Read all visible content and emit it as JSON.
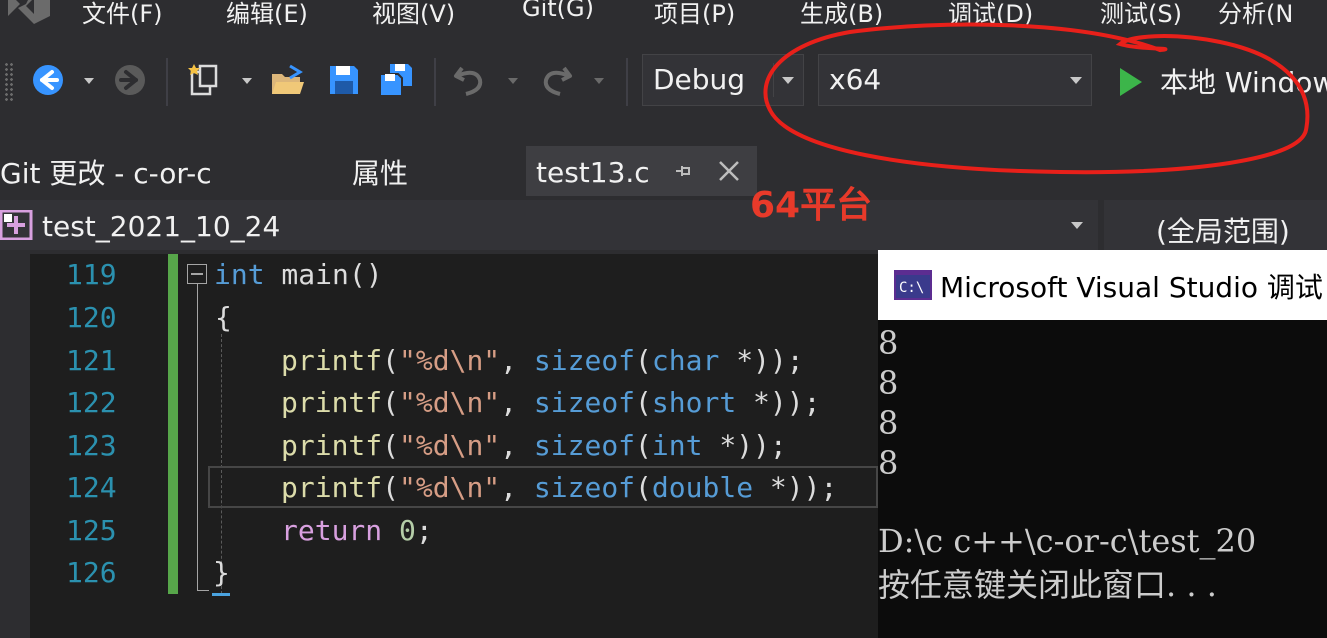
{
  "menu": {
    "items": [
      "文件(F)",
      "编辑(E)",
      "视图(V)",
      "Git(G)",
      "项目(P)",
      "生成(B)",
      "调试(D)",
      "测试(S)",
      "分析(N"
    ]
  },
  "toolbar": {
    "configuration": "Debug",
    "platform": "x64",
    "run_label": "本地 Window",
    "icons": [
      "back-arrow-icon",
      "forward-arrow-icon",
      "new-project-icon",
      "open-folder-icon",
      "save-icon",
      "save-all-icon",
      "undo-icon",
      "redo-icon",
      "play-icon"
    ]
  },
  "tabs": {
    "git_changes": "Git 更改 - c-or-c",
    "properties": "属性",
    "active_file": "test13.c"
  },
  "navbar": {
    "project": "test_2021_10_24",
    "scope": "(全局范围)"
  },
  "editor": {
    "line_numbers": [
      "119",
      "120",
      "121",
      "122",
      "123",
      "124",
      "125",
      "126"
    ],
    "code": {
      "l119_kw": "int",
      "l119_rest": " main()",
      "l120": "{",
      "printf": "printf",
      "open": "(",
      "fmt": "\"%d\\n\"",
      "comma": ", ",
      "sizeof": "sizeof",
      "t121": "char",
      "t122": "short",
      "t123": "int",
      "t124": "double",
      "ptr_close": " *));",
      "l125_kw": "return",
      "l125_num": "0",
      "semi": ";",
      "l126": "}"
    }
  },
  "console": {
    "title": "Microsoft Visual Studio 调试",
    "output_lines": [
      "8",
      "8",
      "8",
      "8"
    ],
    "path_line": "D:\\c c++\\c-or-c\\test_20",
    "prompt_line": "按任意键关闭此窗口. . ."
  },
  "annotation": {
    "text": "64平台",
    "color": "#e83a2a"
  },
  "colors": {
    "keyword": "#569cd6",
    "string": "#d69d85",
    "line_number": "#2b91af",
    "change_bar": "#57a64a"
  }
}
